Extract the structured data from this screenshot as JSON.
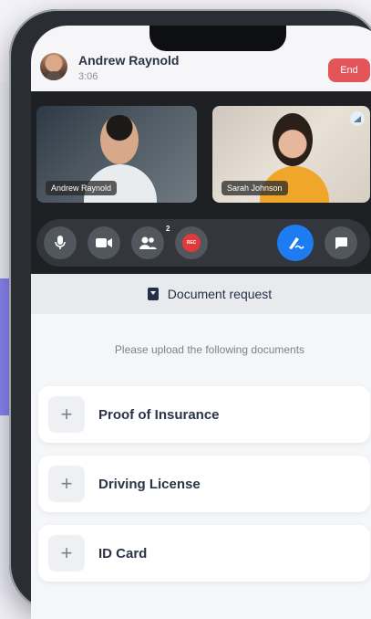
{
  "call": {
    "caller_name": "Andrew Raynold",
    "duration": "3:06",
    "end_label": "End"
  },
  "video": {
    "tiles": [
      {
        "name": "Andrew Raynold"
      },
      {
        "name": "Sarah Johnson"
      }
    ]
  },
  "controls": {
    "participants_count": "2",
    "rec_label": "REC",
    "icons": [
      "microphone-icon",
      "video-camera-icon",
      "participants-icon",
      "record-icon",
      "signature-icon",
      "chat-icon"
    ]
  },
  "documents": {
    "title": "Document request",
    "instructions": "Please upload the following documents",
    "items": [
      {
        "label": "Proof of Insurance"
      },
      {
        "label": "Driving License"
      },
      {
        "label": "ID Card"
      }
    ]
  },
  "colors": {
    "accent": "#1e7cf2",
    "end": "#e4555a",
    "record": "#e23a3a",
    "side_accent": "#8b84f2"
  }
}
